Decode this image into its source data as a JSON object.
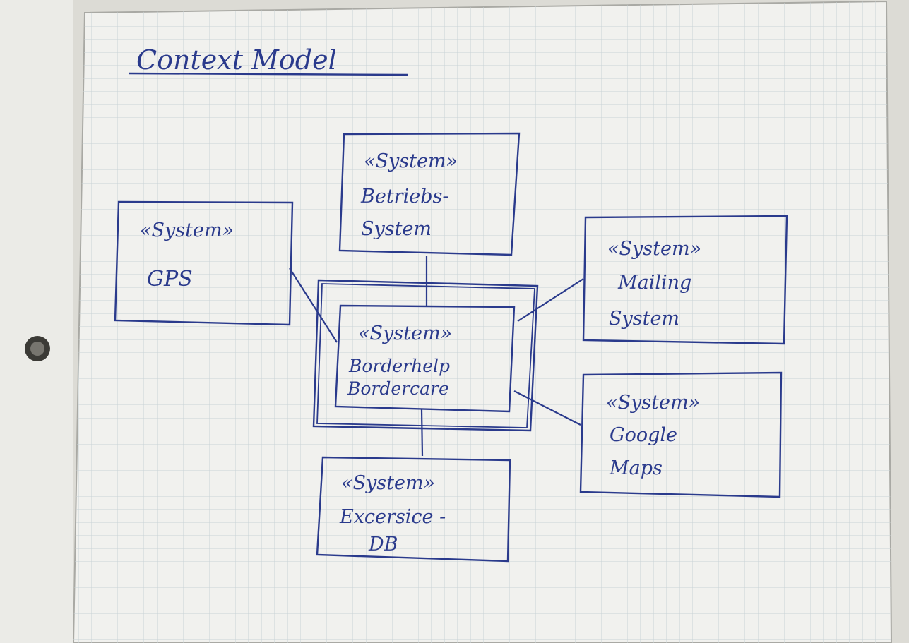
{
  "title": "Context Model",
  "ink_color": "#2a3a8c",
  "paper_color": "#f1f1ee",
  "grid_color": "#c9d3d6",
  "systems": [
    {
      "id": "betriebssystem",
      "stereotype": "«System»",
      "lines": [
        "Betriebs-",
        "System"
      ]
    },
    {
      "id": "gps",
      "stereotype": "«System»",
      "lines": [
        "GPS"
      ]
    },
    {
      "id": "borderhelp",
      "stereotype": "«System»",
      "lines": [
        "Borderhelp",
        "Bordercare"
      ]
    },
    {
      "id": "mailing",
      "stereotype": "«System»",
      "lines": [
        "Mailing",
        "System"
      ]
    },
    {
      "id": "google-maps",
      "stereotype": "«System»",
      "lines": [
        "Google",
        "Maps"
      ]
    },
    {
      "id": "exercise-db",
      "stereotype": "«System»",
      "lines": [
        "Excersice -",
        "DB"
      ]
    }
  ],
  "connections": [
    {
      "from": "betriebssystem",
      "to": "borderhelp"
    },
    {
      "from": "gps",
      "to": "borderhelp"
    },
    {
      "from": "mailing",
      "to": "borderhelp"
    },
    {
      "from": "google-maps",
      "to": "borderhelp"
    },
    {
      "from": "exercise-db",
      "to": "borderhelp"
    }
  ]
}
